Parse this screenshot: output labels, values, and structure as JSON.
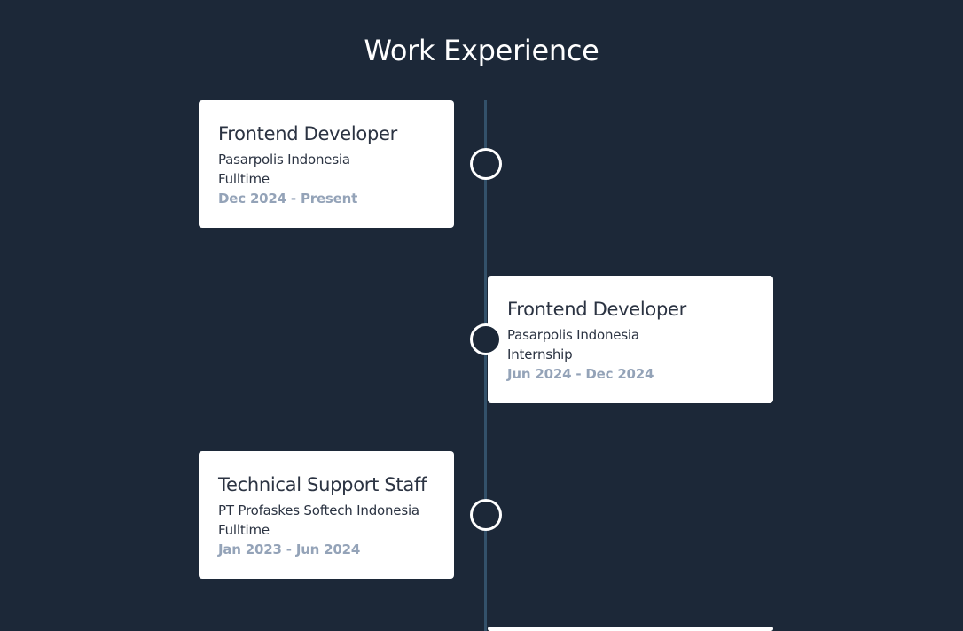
{
  "header": {
    "title": "Work Experience"
  },
  "experiences": [
    {
      "role": "Frontend Developer",
      "company": "Pasarpolis Indonesia",
      "type": "Fulltime",
      "dates": "Dec 2024 - Present"
    },
    {
      "role": "Frontend Developer",
      "company": "Pasarpolis Indonesia",
      "type": "Internship",
      "dates": "Jun 2024 - Dec 2024"
    },
    {
      "role": "Technical Support Staff",
      "company": "PT Profaskes Softech Indonesia",
      "type": "Fulltime",
      "dates": "Jan 2023 - Jun 2024"
    }
  ],
  "colors": {
    "background": "#1c2838",
    "card": "#ffffff",
    "line": "#33516a",
    "muted": "#94a3b8"
  }
}
